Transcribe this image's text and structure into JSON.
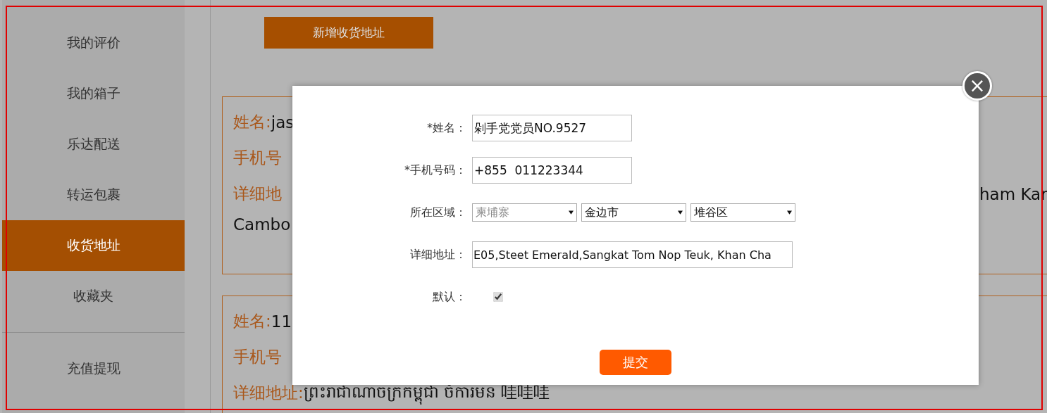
{
  "sidebar": {
    "items": [
      {
        "label": "我的评价",
        "selected": false
      },
      {
        "label": "我的箱子",
        "selected": false
      },
      {
        "label": "乐达配送",
        "selected": false
      },
      {
        "label": "转运包裹",
        "selected": false
      },
      {
        "label": "收货地址",
        "selected": true
      },
      {
        "label": "收藏夹",
        "selected": false
      }
    ],
    "footer_items": [
      {
        "label": "充值提现",
        "selected": false
      }
    ]
  },
  "add_button": "新增收货地址",
  "address_cards": [
    {
      "lines": [
        {
          "label": "姓名:",
          "value": "jas"
        },
        {
          "label": "手机号"
        },
        {
          "label": "详细地",
          "tail": "ham Kar"
        },
        {
          "value": "Cambo"
        }
      ]
    },
    {
      "lines": [
        {
          "label": "姓名:",
          "value": "11"
        },
        {
          "label": "手机号"
        },
        {
          "label": "详细地址:",
          "value": "ព្រះរាជាណាចក្រកម្ពុជា ចំការមន 哇哇哇"
        }
      ]
    }
  ],
  "dialog": {
    "fields": [
      {
        "kind": "text",
        "label": "*姓名：",
        "value": "剁手党党员NO.9527"
      },
      {
        "kind": "text",
        "label": "*手机号码：",
        "value": "+855  011223344"
      },
      {
        "kind": "selects",
        "label": "所在区域：",
        "options": [
          {
            "value": "柬埔寨",
            "disabled": true
          },
          {
            "value": "金边市",
            "disabled": false
          },
          {
            "value": "堆谷区",
            "disabled": false
          }
        ]
      },
      {
        "kind": "wide",
        "label": "详细地址：",
        "value": "E05,Steet Emerald,Sangkat Tom Nop Teuk, Khan Cha"
      },
      {
        "kind": "checkbox",
        "label": "默认：",
        "checked": true
      }
    ],
    "submit": "提交",
    "close": "×"
  }
}
